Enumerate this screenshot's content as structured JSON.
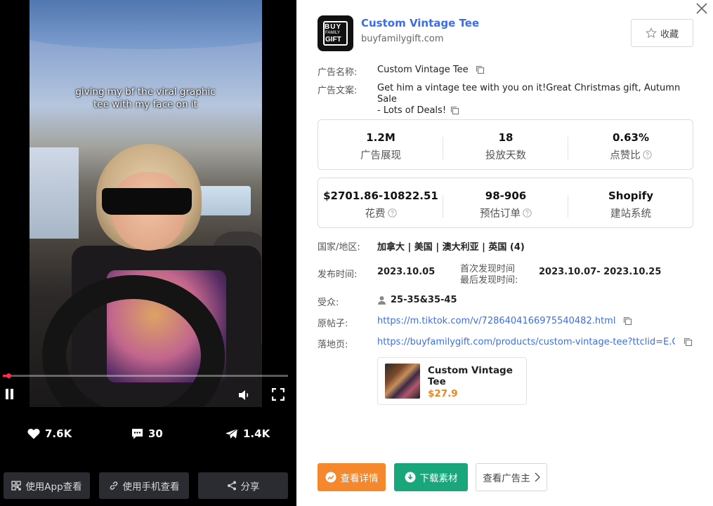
{
  "video": {
    "caption": "giving my bf the viral graphic tee with my face on it",
    "progress_fraction": 0.02
  },
  "engagement": {
    "likes": "7.6K",
    "comments": "30",
    "shares": "1.4K"
  },
  "left_actions": {
    "app_view": "使用App查看",
    "phone_view": "使用手机查看",
    "share": "分享"
  },
  "advertiser": {
    "name": "Custom Vintage Tee",
    "domain": "buyfamilygift.com",
    "logo_text": [
      "BUY",
      "FAMILY",
      "GIFT"
    ],
    "favorite_label": "收藏"
  },
  "ad": {
    "name_label": "广告名称:",
    "name": "Custom Vintage Tee",
    "copy_label": "广告文案:",
    "copy_line1": "Get him a vintage tee with you on it!Great Christmas gift, Autumn Sale",
    "copy_line2": "- Lots of Deals!"
  },
  "metrics_row1": [
    {
      "value": "1.2M",
      "caption": "广告展现"
    },
    {
      "value": "18",
      "caption": "投放天数"
    },
    {
      "value": "0.63%",
      "caption": "点赞比"
    }
  ],
  "metrics_row2": [
    {
      "value": "$2701.86-10822.51",
      "caption": "花费"
    },
    {
      "value": "98-906",
      "caption": "预估订单"
    },
    {
      "value": "Shopify",
      "caption": "建站系统"
    }
  ],
  "info": {
    "region_label": "国家/地区:",
    "region_value": "加拿大 | 美国 | 澳大利亚 | 英国 (4)",
    "publish_label": "发布时间:",
    "publish_value": "2023.10.05",
    "first_seen_label": "首次发现时间",
    "last_seen_label": "最后发现时间:",
    "seen_range": "2023.10.07- 2023.10.25",
    "audience_label": "受众:",
    "audience_value": "25-35&35-45",
    "post_label": "原帖子:",
    "post_url": "https://m.tiktok.com/v/7286404166975540482.html",
    "landing_label": "落地页:",
    "landing_url": "https://buyfamilygift.com/products/custom-vintage-tee?ttclid=E.C...."
  },
  "product": {
    "title": "Custom Vintage Tee",
    "price": "$27.9"
  },
  "actions": {
    "details": "查看详情",
    "download": "下载素材",
    "advertiser": "查看广告主"
  },
  "colors": {
    "link": "#3b6ee6",
    "orange": "#f5872d",
    "green": "#18a67a",
    "price": "#f08519",
    "progress": "#ff2b54"
  }
}
